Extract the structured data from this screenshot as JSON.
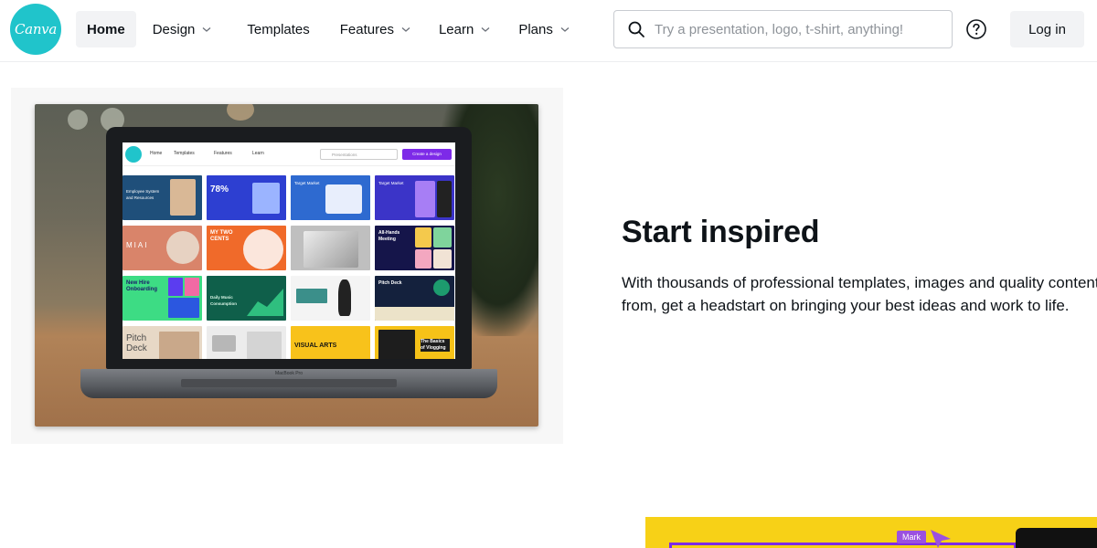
{
  "header": {
    "logo_text": "Canva",
    "nav": [
      {
        "label": "Home",
        "active": true,
        "has_dropdown": false
      },
      {
        "label": "Design",
        "active": false,
        "has_dropdown": true
      },
      {
        "label": "Templates",
        "active": false,
        "has_dropdown": false
      },
      {
        "label": "Features",
        "active": false,
        "has_dropdown": true
      },
      {
        "label": "Learn",
        "active": false,
        "has_dropdown": true
      },
      {
        "label": "Plans",
        "active": false,
        "has_dropdown": true
      }
    ],
    "search_placeholder": "Try a presentation, logo, t-shirt, anything!",
    "search_value": "",
    "help_icon": "question-circle-icon",
    "login_label": "Log in"
  },
  "hero": {
    "screen": {
      "nav": [
        "Home",
        "Templates",
        "Features",
        "Learn"
      ],
      "search_placeholder": "Presentations",
      "cta_label": "Create a design",
      "tiles": [
        "Employee System and Resources",
        "78%",
        "Target Market",
        "Target Market",
        "MIAI",
        "MY TWO CENTS",
        "",
        "All-Hands Meeting",
        "New Hire Onboarding",
        "Daily Music Consumption",
        "",
        "Pitch Deck",
        "Pitch Deck",
        "",
        "VISUAL ARTS",
        "The Basics of Vlogging"
      ],
      "base_label": "MacBook Pro"
    },
    "title": "Start inspired",
    "description": "With thousands of professional templates, images and quality content from, get a headstart on bringing your best ideas and work to life."
  },
  "peek": {
    "badge": "Mark"
  },
  "colors": {
    "brand_teal": "#20c4cb",
    "brand_purple": "#7d2ae8",
    "peek_yellow": "#f7d117",
    "text": "#0e1318",
    "active_nav_bg": "#f2f3f5"
  }
}
